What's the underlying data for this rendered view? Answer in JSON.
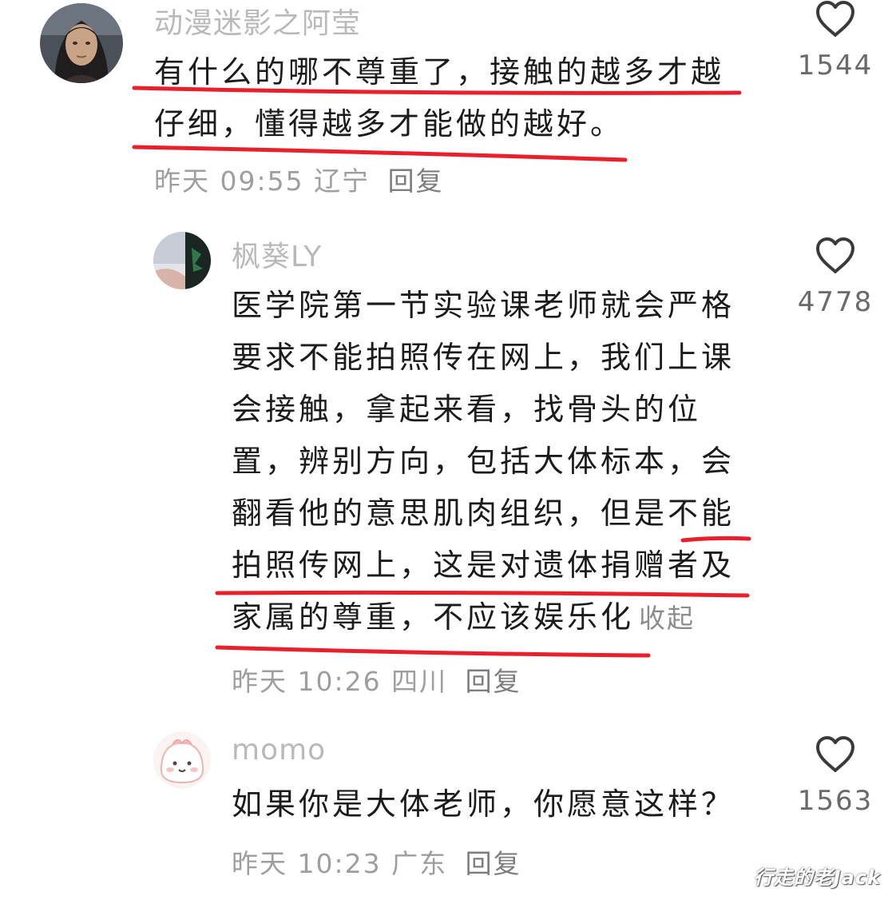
{
  "comments": [
    {
      "username": "动漫迷影之阿莹",
      "body_lines": [
        "有什么的哪不尊重了，接触的越多才越",
        "仔细，懂得越多才能做的越好。"
      ],
      "date": "昨天 09:55",
      "location": "辽宁",
      "reply_label": "回复",
      "likes": "1544",
      "avatar_icon": "woman-portrait-avatar"
    },
    {
      "username": "枫葵LY",
      "body_lines": [
        "医学院第一节实验课老师就会严格",
        "要求不能拍照传在网上，我们上课",
        "会接触，拿起来看，找骨头的位",
        "置，辨别方向，包括大体标本，会",
        "翻看他的意思肌肉组织，但是不能",
        "拍照传网上，这是对遗体捐赠者及",
        "家属的尊重，不应该娱乐化"
      ],
      "collapse_label": "收起",
      "date": "昨天 10:26",
      "location": "四川",
      "reply_label": "回复",
      "likes": "4778",
      "avatar_icon": "landscape-avatar"
    },
    {
      "username": "momo",
      "body_lines": [
        "如果你是大体老师，你愿意这样？"
      ],
      "date": "昨天 10:23",
      "location": "广东",
      "reply_label": "回复",
      "likes": "1563",
      "avatar_icon": "cartoon-face-avatar"
    }
  ],
  "watermark": "行走的老Jack",
  "colors": {
    "annotation_red": "#e8202c",
    "username": "#b9b9b9",
    "body_text": "#1b1b1b",
    "meta_text": "#9e9e9e"
  }
}
